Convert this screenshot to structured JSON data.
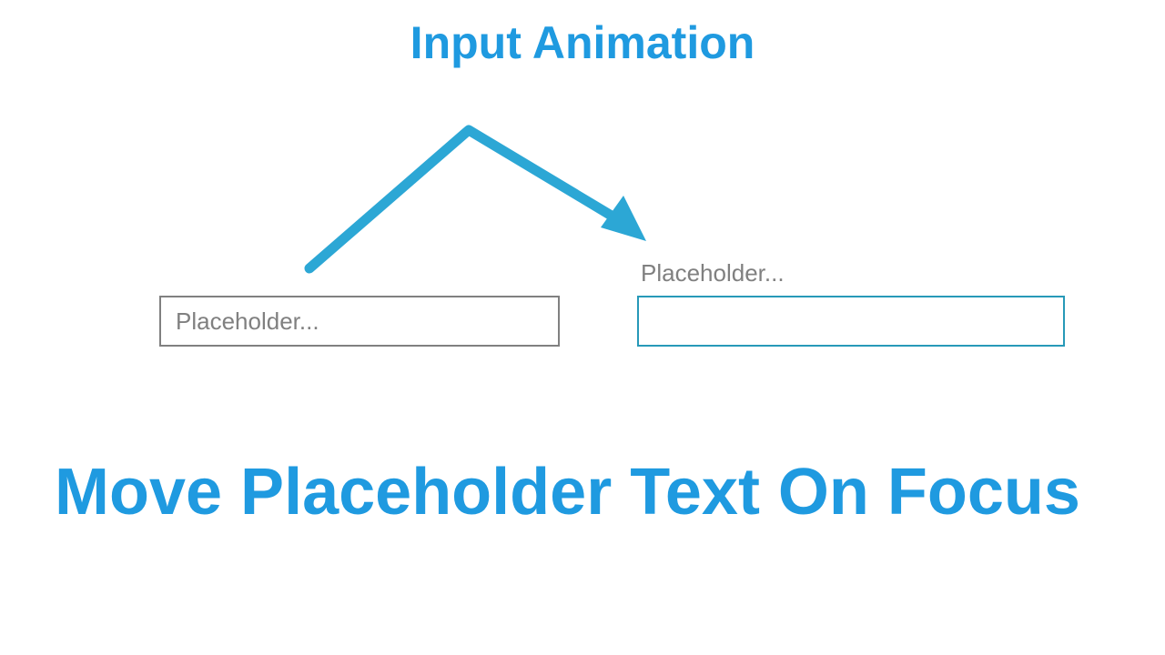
{
  "title": "Input Animation",
  "input_unfocused": {
    "placeholder": "Placeholder..."
  },
  "input_focused": {
    "floating_label": "Placeholder..."
  },
  "subtitle": "Move Placeholder Text On Focus",
  "colors": {
    "accent": "#1f9ae0",
    "teal": "#2799b8",
    "gray": "#808080"
  }
}
